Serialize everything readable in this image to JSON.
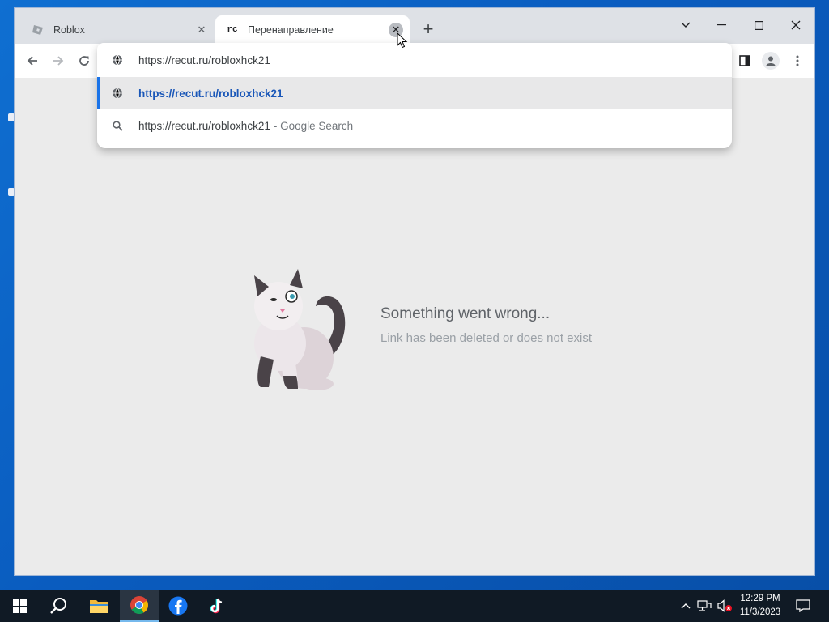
{
  "browser": {
    "tabs": [
      {
        "title": "Roblox",
        "favicon": "roblox-icon",
        "active": false
      },
      {
        "title": "Перенаправление",
        "favicon_text": "rc",
        "active": true
      }
    ],
    "new_tab_label": "+",
    "omnibox": {
      "value": "https://recut.ru/robloxhck21",
      "suggestions": [
        {
          "text": "https://recut.ru/robloxhck21",
          "icon": "globe-icon",
          "selected": true
        },
        {
          "text": "https://recut.ru/robloxhck21",
          "suffix": "- Google Search",
          "icon": "search-icon",
          "selected": false
        }
      ]
    }
  },
  "page": {
    "error_title": "Something went wrong...",
    "error_subtitle": "Link has been deleted or does not exist"
  },
  "taskbar": {
    "apps": [
      "start-icon",
      "search-icon",
      "file-explorer-icon",
      "chrome-icon",
      "facebook-icon",
      "tiktok-icon"
    ],
    "clock_time": "12:29 PM",
    "clock_date": "11/3/2023"
  },
  "colors": {
    "accent": "#1a73e8",
    "desktop": "#0a5cbf",
    "taskbar": "#101a25"
  }
}
